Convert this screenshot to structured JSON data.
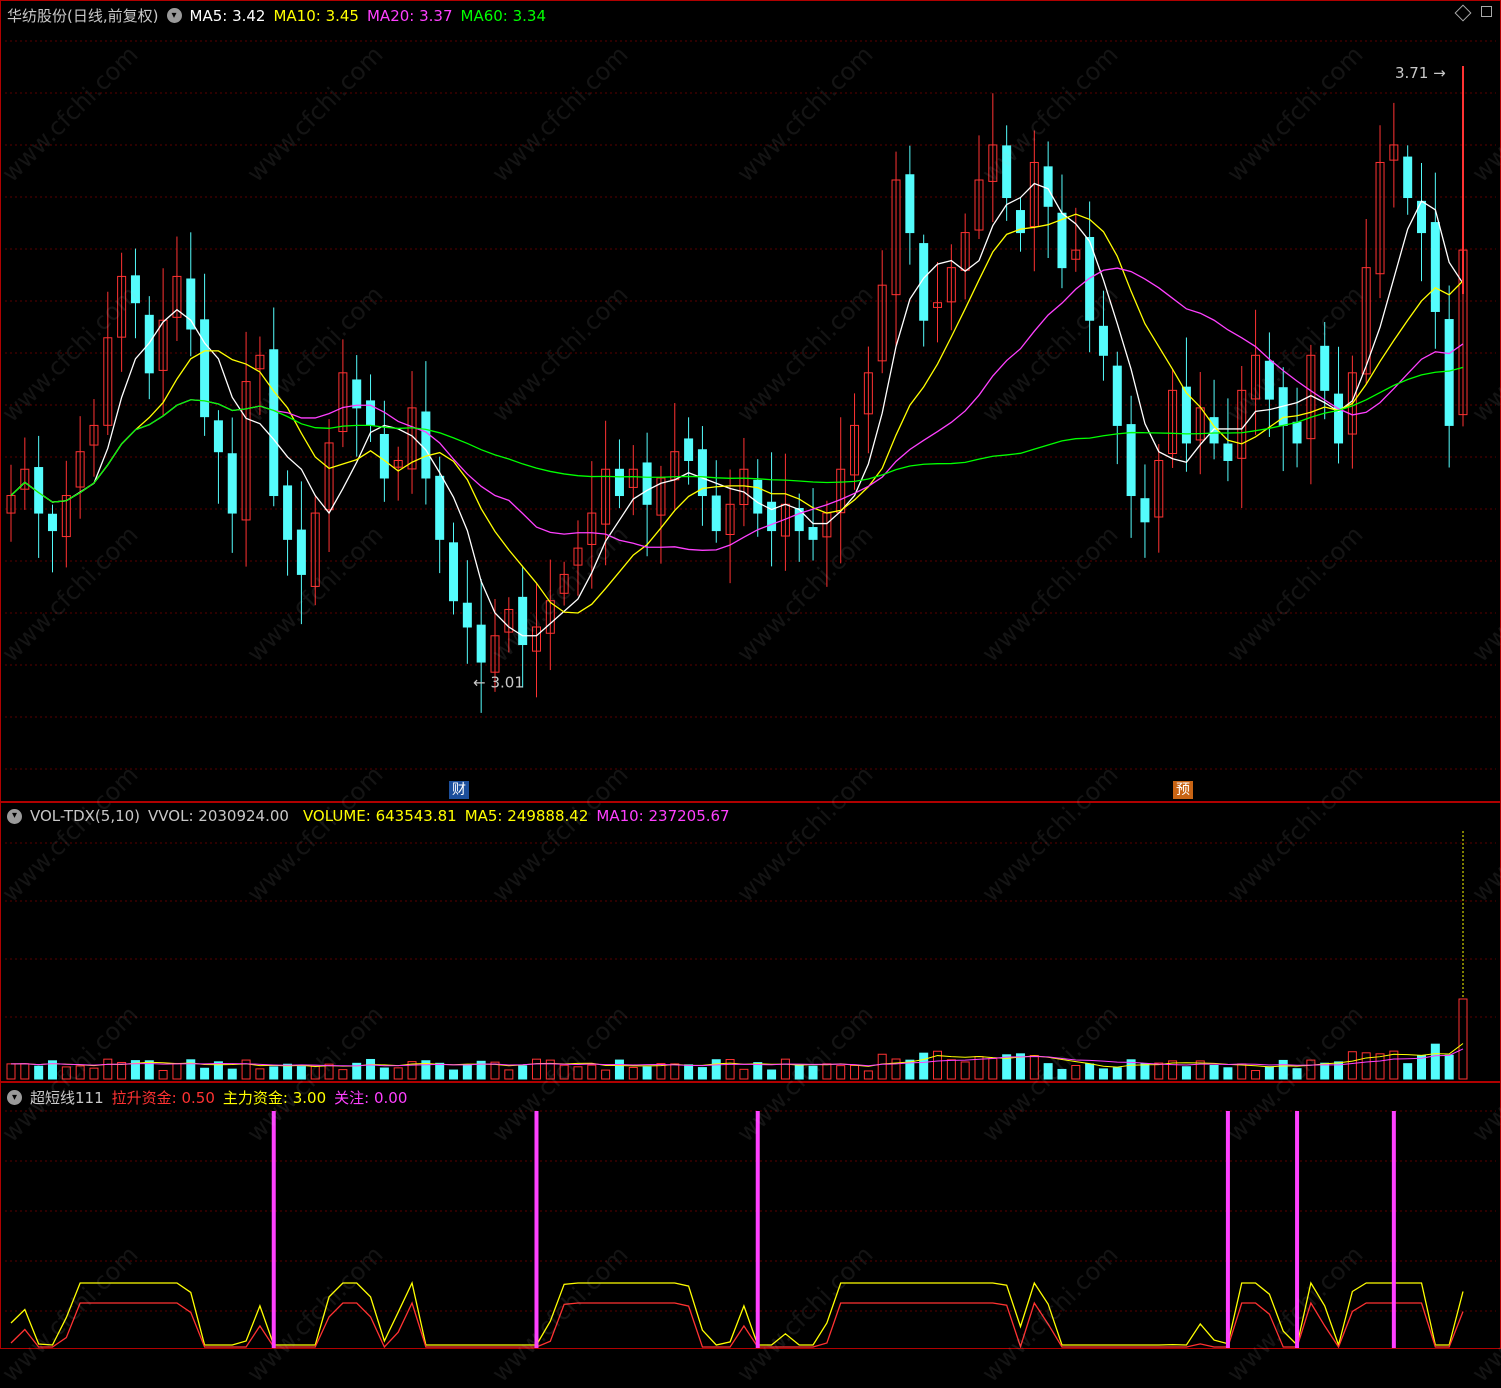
{
  "price": {
    "stock_name": "华纺股份",
    "period": "(日线,前复权)",
    "ma_labels": [
      {
        "label": "MA5: 3.42",
        "color": "#ffffff"
      },
      {
        "label": "MA10: 3.45",
        "color": "#ffff00"
      },
      {
        "label": "MA20: 3.37",
        "color": "#ff40ff"
      },
      {
        "label": "MA60: 3.34",
        "color": "#00ff00"
      }
    ],
    "high_label": "3.71",
    "low_label": "3.01",
    "badge_cai": "财",
    "badge_yu": "预"
  },
  "volume": {
    "indicator": "VOL-TDX(5,10)",
    "vvol": "VVOL: 2030924.00",
    "volume": "VOLUME: 643543.81",
    "ma5": "MA5: 249888.42",
    "ma10": "MA10: 237205.67"
  },
  "indicator": {
    "name": "超短线111",
    "lift_label": "拉升资金",
    "lift_value": ": 0.50",
    "main_label": "主力资金",
    "main_value": ": 3.00",
    "focus_label": "关注",
    "focus_value": ": 0.00"
  },
  "watermark": "www.cfchi.com",
  "colors": {
    "up": "#ff3232",
    "down": "#54fcfc",
    "ma5": "#ffffff",
    "ma10": "#ffff00",
    "ma20": "#ff40ff",
    "ma60": "#00ff00",
    "frame": "#b00000"
  },
  "chart_data": {
    "type": "line",
    "price_range": [
      2.9,
      3.75
    ],
    "high": 3.71,
    "low": 3.01,
    "close_series": [
      3.22,
      3.25,
      3.2,
      3.18,
      3.22,
      3.27,
      3.3,
      3.4,
      3.47,
      3.44,
      3.36,
      3.42,
      3.47,
      3.41,
      3.31,
      3.27,
      3.2,
      3.35,
      3.38,
      3.22,
      3.17,
      3.13,
      3.2,
      3.28,
      3.36,
      3.32,
      3.3,
      3.24,
      3.26,
      3.32,
      3.24,
      3.17,
      3.1,
      3.07,
      3.03,
      3.06,
      3.09,
      3.05,
      3.07,
      3.1,
      3.13,
      3.16,
      3.2,
      3.25,
      3.22,
      3.25,
      3.21,
      3.24,
      3.27,
      3.26,
      3.22,
      3.18,
      3.21,
      3.25,
      3.2,
      3.18,
      3.21,
      3.18,
      3.17,
      3.2,
      3.25,
      3.3,
      3.36,
      3.46,
      3.58,
      3.52,
      3.42,
      3.44,
      3.48,
      3.52,
      3.58,
      3.62,
      3.56,
      3.52,
      3.6,
      3.55,
      3.48,
      3.5,
      3.42,
      3.38,
      3.3,
      3.22,
      3.19,
      3.26,
      3.34,
      3.28,
      3.32,
      3.28,
      3.26,
      3.34,
      3.38,
      3.33,
      3.3,
      3.28,
      3.38,
      3.34,
      3.28,
      3.36,
      3.48,
      3.6,
      3.62,
      3.56,
      3.52,
      3.43,
      3.3,
      3.5
    ]
  }
}
